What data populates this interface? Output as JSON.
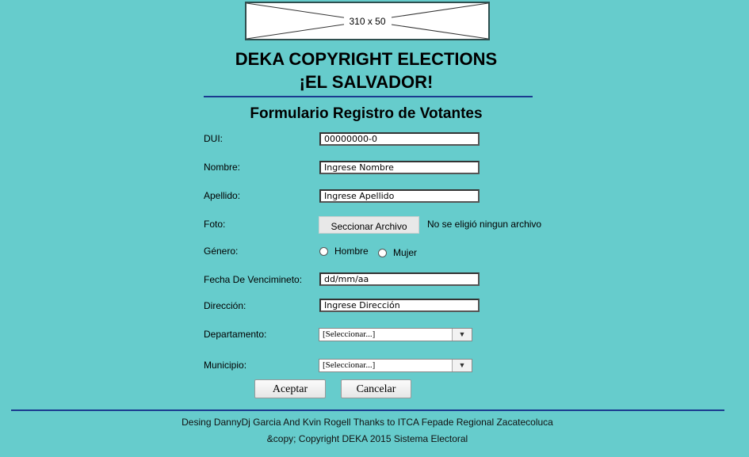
{
  "header": {
    "image_placeholder": "310 x 50",
    "title_line1": "DEKA COPYRIGHT ELECTIONS",
    "title_line2": "¡EL SALVADOR!"
  },
  "form": {
    "title": "Formulario Registro de Votantes",
    "dui": {
      "label": "DUI:",
      "value": "00000000-0"
    },
    "nombre": {
      "label": "Nombre:",
      "placeholder": "Ingrese Nombre"
    },
    "apellido": {
      "label": "Apellido:",
      "placeholder": "Ingrese Apellido"
    },
    "foto": {
      "label": "Foto:",
      "button": "Seccionar Archivo",
      "status": "No se eligió ningun archivo"
    },
    "genero": {
      "label": "Género:",
      "options": [
        "Hombre",
        "Mujer"
      ]
    },
    "fecha": {
      "label": "Fecha De Vencimineto:",
      "placeholder": "dd/mm/aa"
    },
    "direccion": {
      "label": "Dirección:",
      "placeholder": "Ingrese Dirección"
    },
    "departamento": {
      "label": "Departamento:",
      "selected": "[Seleccionar...]"
    },
    "municipio": {
      "label": "Municipio:",
      "selected": "[Seleccionar...]"
    },
    "buttons": {
      "accept": "Aceptar",
      "cancel": "Cancelar"
    }
  },
  "footer": {
    "line1": "Desing DannyDj Garcia And Kvin Rogell Thanks to ITCA Fepade Regional Zacatecoluca",
    "line2": "&copy; Copyright DEKA 2015 Sistema Electoral"
  },
  "colors": {
    "background": "#66cccc",
    "rule": "#1a3a8f"
  }
}
